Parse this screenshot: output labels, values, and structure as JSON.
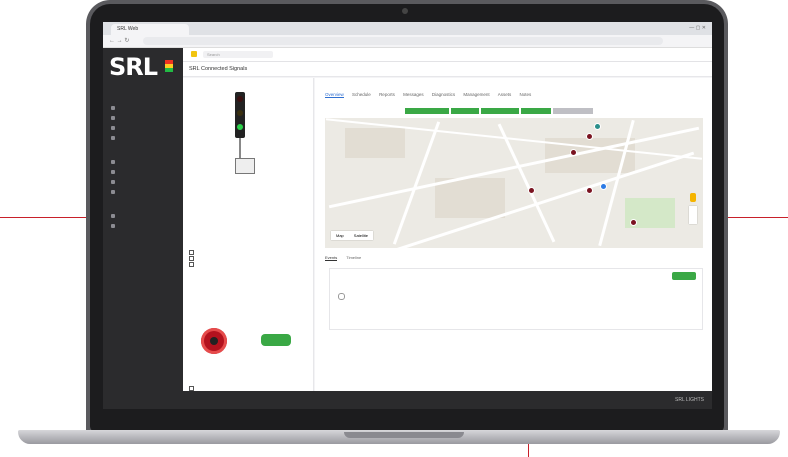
{
  "window": {
    "tab_title": "SRL Web",
    "nav_icons": "← → ↻",
    "url": "",
    "controls": "— ▢ ✕"
  },
  "sidebar": {
    "logo_text": "SRL",
    "sections": [
      {
        "title": "",
        "items": [
          "",
          "",
          "",
          ""
        ]
      },
      {
        "title": "",
        "items": [
          "",
          "",
          "",
          ""
        ]
      },
      {
        "title": "",
        "items": [
          "",
          ""
        ]
      }
    ]
  },
  "topbar": {
    "search_placeholder": "Search"
  },
  "page": {
    "title": "SRL Connected Signals"
  },
  "left_panel": {
    "intro_lines": [
      "",
      "",
      ""
    ],
    "group1_title": "",
    "group1_line": "",
    "group2_title": "",
    "group2_items": [
      "",
      "",
      ""
    ],
    "status_title": "",
    "knob_label": "",
    "toggle_text": "",
    "toggle_label": "",
    "toggle_sublabel": "",
    "group3_title": "",
    "group3_items": [
      "",
      "",
      ""
    ]
  },
  "right_panel": {
    "tabs": [
      "Overview",
      "Schedule",
      "Reports",
      "Messages",
      "Diagnostics",
      "Management",
      "Assets",
      "Notes"
    ],
    "active_tab": 0,
    "status_chips": [
      "",
      "",
      "",
      "",
      ""
    ],
    "map": {
      "title": "",
      "type_buttons": [
        "Map",
        "Satellite"
      ],
      "pins": [
        "",
        "",
        "",
        "",
        "",
        "",
        ""
      ]
    },
    "subtabs": [
      "Events",
      "Timeline"
    ],
    "card": {
      "heading": "",
      "button": "",
      "event_title": "",
      "event_date": "",
      "event_lines": [
        "",
        "",
        ""
      ]
    }
  },
  "footer": {
    "left": "",
    "right": "SRL LIGHTS"
  },
  "colors": {
    "accent_green": "#3aa845",
    "sidebar_bg": "#2b2b2d",
    "brand_red": "#c8202a",
    "pin_red": "#7a1320"
  }
}
